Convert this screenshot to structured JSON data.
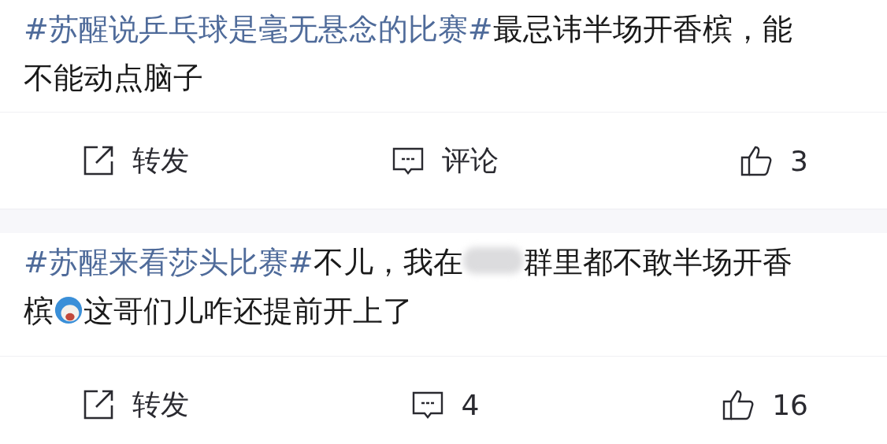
{
  "posts": [
    {
      "segments": [
        {
          "kind": "hashtag",
          "text": "#苏醒说乒乓球是毫无悬念的比赛#"
        },
        {
          "kind": "text",
          "text": "最忌讳半场开香槟，能不能动点脑子"
        }
      ],
      "actions": {
        "repost": "转发",
        "comment": "评论",
        "like": "3"
      }
    },
    {
      "segments": [
        {
          "kind": "hashtag",
          "text": "#苏醒来看莎头比赛#"
        },
        {
          "kind": "text",
          "text": "不儿，我在"
        },
        {
          "kind": "blurred"
        },
        {
          "kind": "text",
          "text": "群里都不敢半场开香槟"
        },
        {
          "kind": "emoji"
        },
        {
          "kind": "text",
          "text": "这哥们儿咋还提前开上了"
        }
      ],
      "actions": {
        "repost": "转发",
        "comment": "4",
        "like": "16"
      }
    }
  ]
}
